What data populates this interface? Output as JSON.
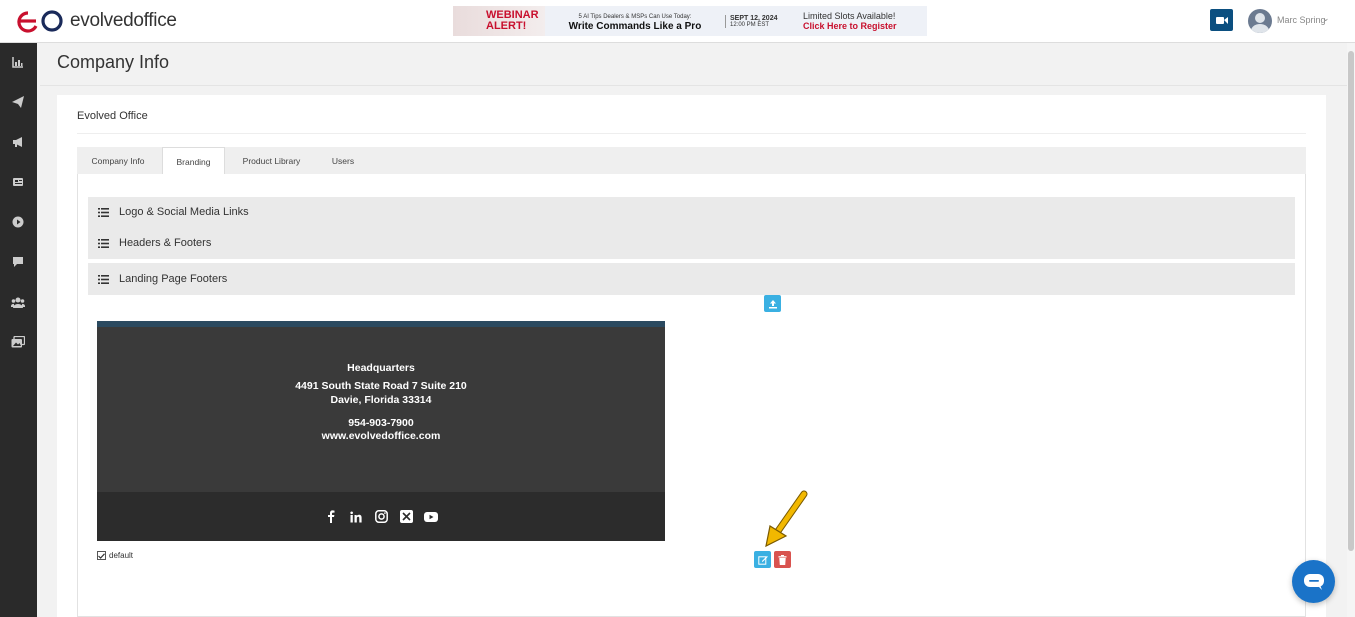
{
  "brand": {
    "name_part1": "evolved",
    "name_part2": "office"
  },
  "banner": {
    "left_line1": "WEBINAR",
    "left_line2": "ALERT!",
    "mid_small": "5 AI Tips Dealers & MSPs Can Use Today:",
    "mid_big": "Write Commands Like a Pro",
    "date": "SEPT 12, 2024",
    "time": "12:00 PM EST",
    "right_line1": "Limited Slots Available!",
    "right_line2": "Click Here to Register"
  },
  "user": {
    "name": "Marc Spring"
  },
  "page": {
    "title": "Company Info"
  },
  "company": {
    "name": "Evolved Office"
  },
  "tabs": [
    {
      "label": "Company Info"
    },
    {
      "label": "Branding"
    },
    {
      "label": "Product Library"
    },
    {
      "label": "Users"
    }
  ],
  "active_tab": "Branding",
  "accordion": [
    {
      "label": "Logo & Social Media Links"
    },
    {
      "label": "Headers & Footers"
    },
    {
      "label": "Landing Page Footers"
    }
  ],
  "footer_preview": {
    "heading": "Headquarters",
    "address1": "4491 South State Road 7 Suite 210",
    "address2": "Davie, Florida 33314",
    "phone": "954-903-7900",
    "website": "www.evolvedoffice.com",
    "social_icons": [
      "facebook-icon",
      "linkedin-icon",
      "instagram-icon",
      "x-icon",
      "youtube-icon"
    ]
  },
  "default_checkbox": {
    "label": "default",
    "checked": true
  },
  "colors": {
    "accent_blue": "#3ab0e2",
    "danger_red": "#d9534f",
    "sidebar": "#2a2a2a",
    "brand_red": "#c8102e",
    "chat_blue": "#1a73c8"
  }
}
